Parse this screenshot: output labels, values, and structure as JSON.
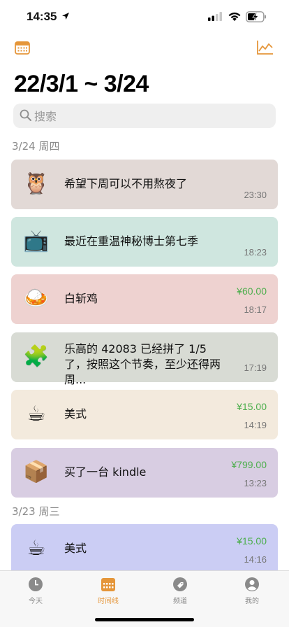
{
  "status_bar": {
    "time": "14:35"
  },
  "header": {
    "title": "22/3/1 ~ 3/24"
  },
  "search": {
    "placeholder": "搜索"
  },
  "sections": [
    {
      "label": "3/24 周四"
    },
    {
      "label": "3/23 周三"
    }
  ],
  "entries": [
    {
      "icon": "🦉",
      "icon_name": "owl-icon",
      "text": "希望下周可以不用熬夜了",
      "price": "",
      "time": "23:30",
      "bg": "#e2d9d6"
    },
    {
      "icon": "📺",
      "icon_name": "tv-icon",
      "text": "最近在重温神秘博士第七季",
      "price": "",
      "time": "18:23",
      "bg": "#cfe6df"
    },
    {
      "icon": "🍛",
      "icon_name": "rice-dish-icon",
      "text": "白斩鸡",
      "price": "¥60.00",
      "time": "18:17",
      "bg": "#eed2d0"
    },
    {
      "icon": "🧩",
      "icon_name": "puzzle-icon",
      "text": "乐高的 42083 已经拼了 1/5 了，按照这个节奏，至少还得两周...",
      "price": "",
      "time": "17:19",
      "bg": "#d8dbd4"
    },
    {
      "icon": "☕",
      "icon_name": "coffee-icon",
      "text": "美式",
      "price": "¥15.00",
      "time": "14:19",
      "bg": "#f3eadd"
    },
    {
      "icon": "📦",
      "icon_name": "package-icon",
      "text": "买了一台 kindle",
      "price": "¥799.00",
      "time": "13:23",
      "bg": "#d8cde2"
    },
    {
      "icon": "☕",
      "icon_name": "coffee-icon",
      "text": "美式",
      "price": "¥15.00",
      "time": "14:16",
      "bg": "#cbcdf4"
    }
  ],
  "tabs": [
    {
      "label": "今天",
      "icon_name": "clock-icon",
      "active": false
    },
    {
      "label": "时间线",
      "icon_name": "calendar-icon",
      "active": true
    },
    {
      "label": "频道",
      "icon_name": "tag-icon",
      "active": false
    },
    {
      "label": "我的",
      "icon_name": "person-icon",
      "active": false
    }
  ],
  "colors": {
    "accent": "#e5963a",
    "price_green": "#4cae4c"
  }
}
